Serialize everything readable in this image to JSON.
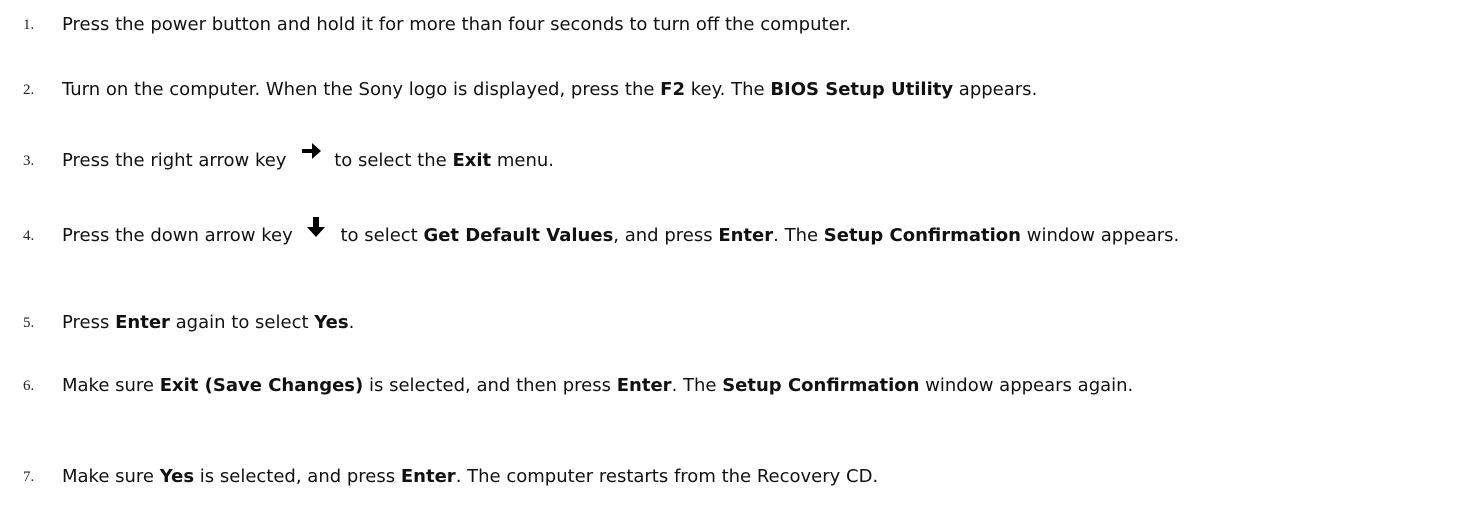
{
  "steps": [
    {
      "number": "1.",
      "segments": [
        {
          "t": "Press the power button and hold it for more than four seconds to turn off the computer."
        }
      ]
    },
    {
      "number": "2.",
      "segments": [
        {
          "t": "Turn on the computer. When the Sony logo is displayed, press the "
        },
        {
          "t": "F2",
          "b": true
        },
        {
          "t": " key. The "
        },
        {
          "t": "BIOS Setup Utility",
          "b": true
        },
        {
          "t": " appears."
        }
      ]
    },
    {
      "number": "3.",
      "segments": [
        {
          "t": "Press the right arrow key "
        },
        {
          "icon": "right-arrow-key-icon"
        },
        {
          "t": "to select the "
        },
        {
          "t": "Exit",
          "b": true
        },
        {
          "t": " menu."
        }
      ]
    },
    {
      "number": "4.",
      "segments": [
        {
          "t": "Press the down arrow key "
        },
        {
          "icon": "down-arrow-key-icon"
        },
        {
          "t": "to select "
        },
        {
          "t": "Get Default Values",
          "b": true
        },
        {
          "t": ", and press "
        },
        {
          "t": "Enter",
          "b": true
        },
        {
          "t": ". The "
        },
        {
          "t": "Setup Confirmation",
          "b": true
        },
        {
          "t": " window appears."
        }
      ]
    },
    {
      "number": "5.",
      "segments": [
        {
          "t": "Press "
        },
        {
          "t": "Enter",
          "b": true
        },
        {
          "t": " again to select "
        },
        {
          "t": "Yes",
          "b": true
        },
        {
          "t": "."
        }
      ]
    },
    {
      "number": "6.",
      "segments": [
        {
          "t": "Make sure "
        },
        {
          "t": "Exit (Save Changes)",
          "b": true
        },
        {
          "t": " is selected, and then press "
        },
        {
          "t": "Enter",
          "b": true
        },
        {
          "t": ". The "
        },
        {
          "t": "Setup Confirmation",
          "b": true
        },
        {
          "t": " window appears again."
        }
      ]
    },
    {
      "number": "7.",
      "segments": [
        {
          "t": "Make sure "
        },
        {
          "t": "Yes",
          "b": true
        },
        {
          "t": " is selected, and press "
        },
        {
          "t": "Enter",
          "b": true
        },
        {
          "t": ". The computer restarts from the Recovery CD."
        }
      ]
    }
  ]
}
